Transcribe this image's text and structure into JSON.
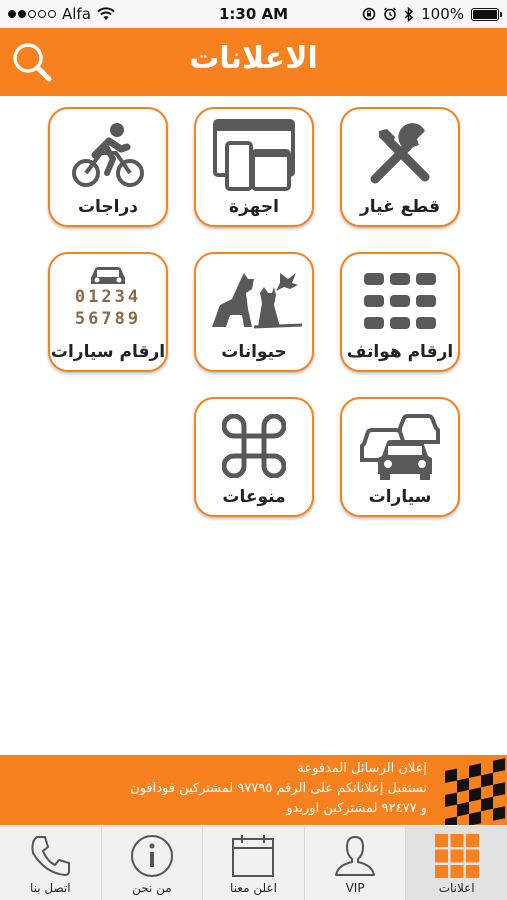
{
  "status_bar": {
    "carrier": "Alfa",
    "time": "1:30 AM",
    "battery": "100%"
  },
  "header": {
    "title": "الاعلانات",
    "search_icon": "search-icon",
    "background_color": "#f7811f"
  },
  "categories": [
    {
      "label": "قطع غيار",
      "icon": "tools-icon"
    },
    {
      "label": "اجهزة",
      "icon": "devices-icon"
    },
    {
      "label": "دراجات",
      "icon": "bicycle-icon"
    },
    {
      "label": "ارقام هواتف",
      "icon": "phone-keypad-icon"
    },
    {
      "label": "حيوانات",
      "icon": "animals-icon"
    },
    {
      "label": "ارقام سيارات",
      "icon": "car-plate-icon",
      "plate_line1": "01234",
      "plate_line2": "56789"
    },
    {
      "label": "سيارات",
      "icon": "cars-icon"
    },
    {
      "label": "منوعات",
      "icon": "command-icon"
    }
  ],
  "banner": {
    "line1": "إعلان الرسائل المدفوعة",
    "line2": "نستقبل إعلاناتكم على الرقم ٩٧٧٩٥ لمشتركين فودافون",
    "line3": "و ٩٢٤٧٧ لمشتركين اوريدو"
  },
  "tabbar": {
    "tabs": [
      {
        "label": "اتصل بنا",
        "icon": "phone-icon"
      },
      {
        "label": "من نحن",
        "icon": "info-icon"
      },
      {
        "label": "اعلن معنا",
        "icon": "calendar-icon"
      },
      {
        "label": "VIP",
        "icon": "user-icon"
      },
      {
        "label": "اعلانات",
        "icon": "grid-icon",
        "active": true
      }
    ]
  }
}
